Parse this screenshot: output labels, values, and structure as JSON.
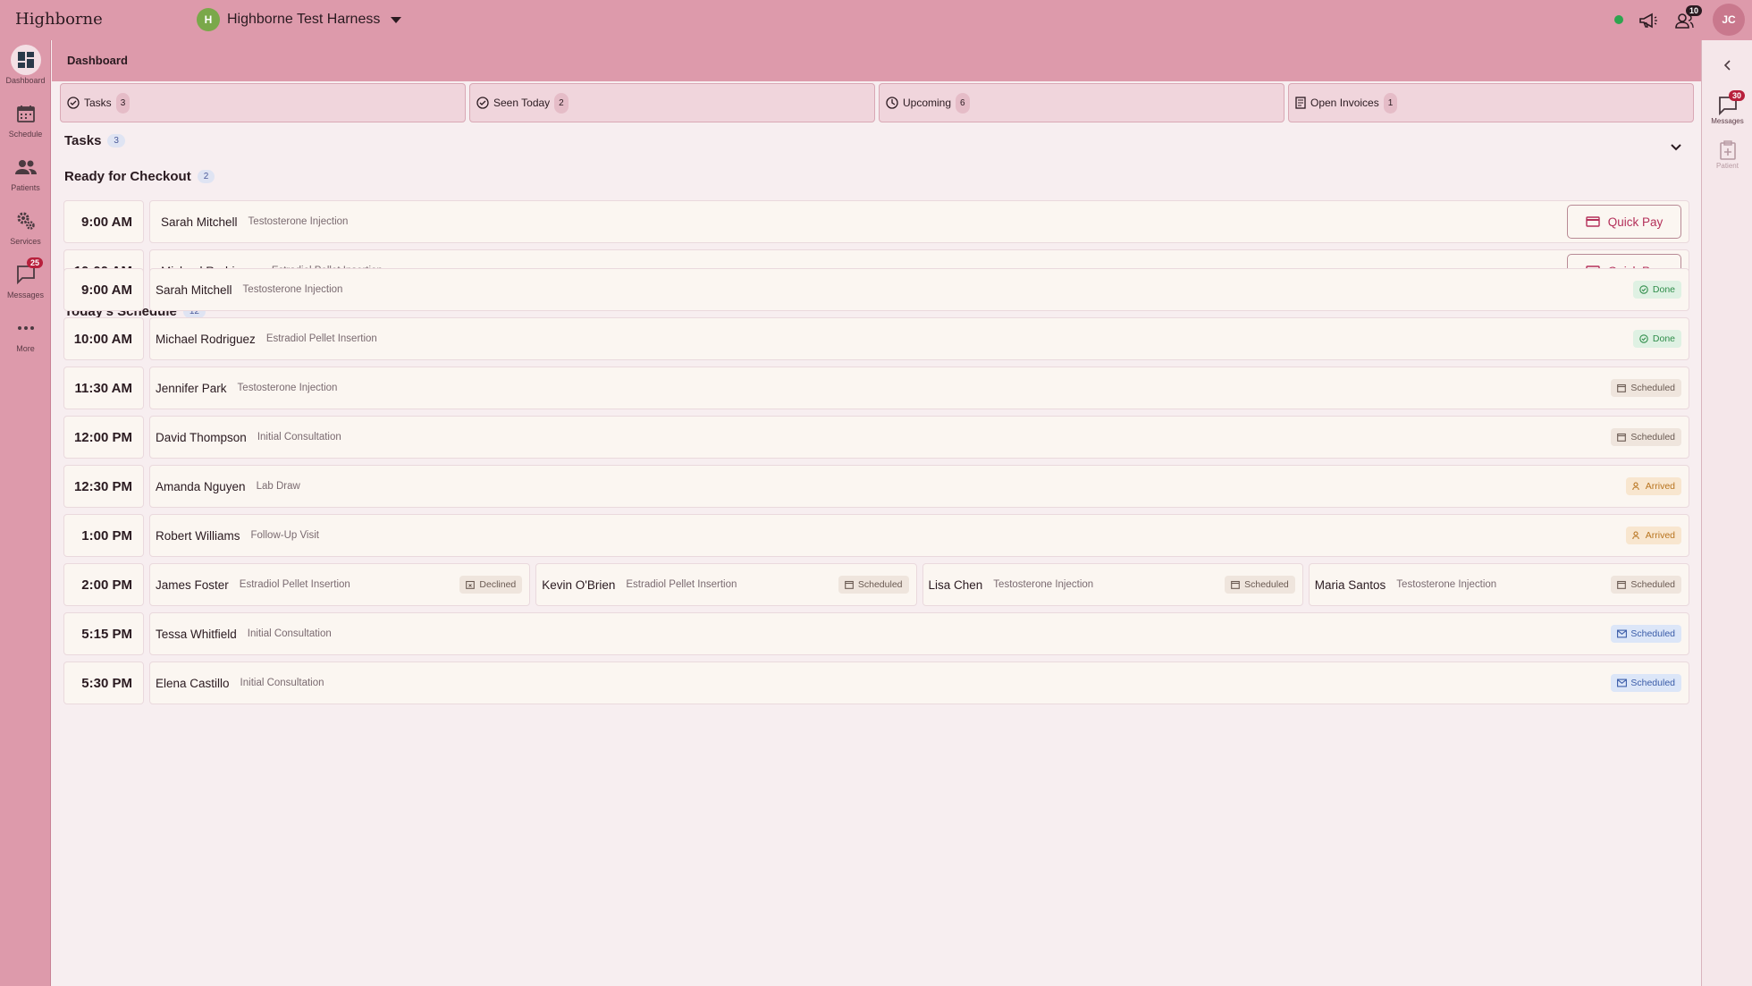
{
  "topbar": {
    "brand": "Highborne",
    "org_initial": "H",
    "org_name": "Highborne Test Harness",
    "notifications_count": "10",
    "user_initials": "JC",
    "online_color": "#2ea44f"
  },
  "sidebar": {
    "items": [
      {
        "label": "Dashboard",
        "icon": "dashboard-icon"
      },
      {
        "label": "Schedule",
        "icon": "calendar-icon"
      },
      {
        "label": "Patients",
        "icon": "patients-icon"
      },
      {
        "label": "Services",
        "icon": "gears-icon"
      },
      {
        "label": "Messages",
        "icon": "chat-icon",
        "badge": "25"
      },
      {
        "label": "More",
        "icon": "more-icon"
      }
    ]
  },
  "rightpanel": {
    "items": [
      {
        "label": "Messages",
        "badge": "30"
      },
      {
        "label": "Patient"
      }
    ]
  },
  "page": {
    "title": "Dashboard"
  },
  "stats": [
    {
      "label": "Tasks",
      "count": "3"
    },
    {
      "label": "Seen Today",
      "count": "2"
    },
    {
      "label": "Upcoming",
      "count": "6"
    },
    {
      "label": "Open Invoices",
      "count": "1"
    }
  ],
  "tasks": {
    "title": "Tasks",
    "count": "3",
    "checkout": {
      "title": "Ready for Checkout",
      "count": "2",
      "quickpay_label": "Quick Pay",
      "rows": [
        {
          "time": "9:00 AM",
          "name": "Sarah Mitchell",
          "service": "Testosterone Injection"
        },
        {
          "time": "10:00 AM",
          "name": "Michael Rodriguez",
          "service": "Estradiol Pellet Insertion"
        }
      ]
    }
  },
  "schedule": {
    "title": "Today's Schedule",
    "count": "12",
    "rows": [
      {
        "time": "9:00 AM",
        "appts": [
          {
            "name": "Sarah Mitchell",
            "service": "Testosterone Injection",
            "status": "Done",
            "kind": "done"
          }
        ]
      },
      {
        "time": "10:00 AM",
        "appts": [
          {
            "name": "Michael Rodriguez",
            "service": "Estradiol Pellet Insertion",
            "status": "Done",
            "kind": "done"
          }
        ]
      },
      {
        "time": "11:30 AM",
        "appts": [
          {
            "name": "Jennifer Park",
            "service": "Testosterone Injection",
            "status": "Scheduled",
            "kind": "scheduled"
          }
        ]
      },
      {
        "time": "12:00 PM",
        "appts": [
          {
            "name": "David Thompson",
            "service": "Initial Consultation",
            "status": "Scheduled",
            "kind": "scheduled"
          }
        ]
      },
      {
        "time": "12:30 PM",
        "appts": [
          {
            "name": "Amanda Nguyen",
            "service": "Lab Draw",
            "status": "Arrived",
            "kind": "arrived"
          }
        ]
      },
      {
        "time": "1:00 PM",
        "appts": [
          {
            "name": "Robert Williams",
            "service": "Follow-Up Visit",
            "status": "Arrived",
            "kind": "arrived"
          }
        ]
      },
      {
        "time": "2:00 PM",
        "appts": [
          {
            "name": "James Foster",
            "service": "Estradiol Pellet Insertion",
            "status": "Declined",
            "kind": "declined"
          },
          {
            "name": "Kevin O'Brien",
            "service": "Estradiol Pellet Insertion",
            "status": "Scheduled",
            "kind": "scheduled"
          },
          {
            "name": "Lisa Chen",
            "service": "Testosterone Injection",
            "status": "Scheduled",
            "kind": "scheduled"
          },
          {
            "name": "Maria Santos",
            "service": "Testosterone Injection",
            "status": "Scheduled",
            "kind": "scheduled"
          }
        ]
      },
      {
        "time": "5:15 PM",
        "appts": [
          {
            "name": "Tessa Whitfield",
            "service": "Initial Consultation",
            "status": "Scheduled",
            "kind": "sched-blue"
          }
        ]
      },
      {
        "time": "5:30 PM",
        "appts": [
          {
            "name": "Elena Castillo",
            "service": "Initial Consultation",
            "status": "Scheduled",
            "kind": "sched-blue"
          }
        ]
      }
    ]
  }
}
